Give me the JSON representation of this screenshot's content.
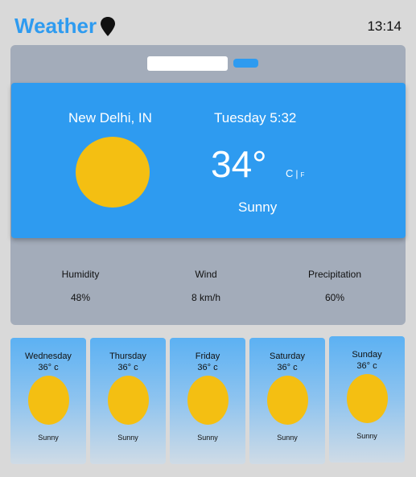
{
  "header": {
    "title": "Weather",
    "time": "13:14"
  },
  "search": {
    "placeholder": "",
    "value": ""
  },
  "current": {
    "location": "New Delhi, IN",
    "datetime": "Tuesday 5:32",
    "temperature": "34°",
    "unit_c": "C",
    "unit_sep": "|",
    "unit_f": "F",
    "condition": "Sunny"
  },
  "stats": [
    {
      "label": "Humidity",
      "value": "48%"
    },
    {
      "label": "Wind",
      "value": "8 km/h"
    },
    {
      "label": "Precipitation",
      "value": "60%"
    }
  ],
  "forecast": [
    {
      "day": "Wednesday",
      "temp": "36° c",
      "condition": "Sunny"
    },
    {
      "day": "Thursday",
      "temp": "36° c",
      "condition": "Sunny"
    },
    {
      "day": "Friday",
      "temp": "36° c",
      "condition": "Sunny"
    },
    {
      "day": "Saturday",
      "temp": "36° c",
      "condition": "Sunny"
    },
    {
      "day": "Sunday",
      "temp": "36° c",
      "condition": "Sunny"
    }
  ],
  "colors": {
    "accent": "#2e9bf0",
    "sun": "#f4bf12",
    "panel": "#a3acba",
    "background": "#d9d9d9"
  },
  "icons": {
    "location": "map-pin-icon",
    "sun": "sun-icon"
  }
}
